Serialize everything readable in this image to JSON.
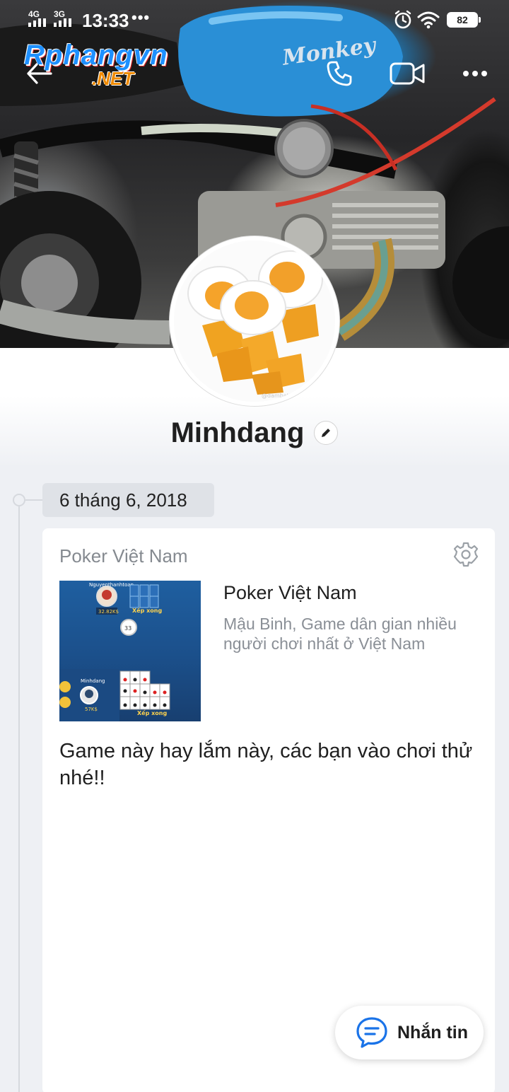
{
  "status_bar": {
    "network_1": "4G",
    "network_2": "3G",
    "time": "13:33",
    "dots": "•••",
    "battery": "82",
    "icons": [
      "alarm-icon",
      "wifi-icon",
      "battery-icon"
    ]
  },
  "cover": {
    "watermark_main": "Rphangvn",
    "watermark_sub": ".NET",
    "tank_text": "Monkey",
    "image_text": "@dambatthydaly"
  },
  "top_actions": {
    "icons": [
      "back-arrow-icon",
      "phone-icon",
      "video-call-icon",
      "more-icon"
    ]
  },
  "profile": {
    "name": "Minhdang",
    "edit_icon": "pencil-icon"
  },
  "timeline": {
    "date": "6 tháng 6, 2018"
  },
  "post": {
    "source": "Poker Việt Nam",
    "settings_icon": "gear-icon",
    "app_title": "Poker Việt Nam",
    "app_description": "Mậu Binh, Game dân gian nhiều người chơi nhất ở Việt Nam",
    "text": "Game này hay lắm này, các bạn vào chơi thử nhé!!",
    "thumbnail": {
      "player_top": "Nguyenthanhtoan",
      "player_top_coins": "32.82K$",
      "status_top": "Xếp xong",
      "timer": "33",
      "player_bottom": "Minhdang",
      "player_bottom_coins": "57K$",
      "status_bottom": "Xếp xong"
    }
  },
  "fab": {
    "label": "Nhắn tin",
    "icon": "chat-bubble-icon"
  },
  "colors": {
    "accent": "#1a73e8",
    "card_bg": "#ffffff",
    "page_bg": "#eef0f4",
    "date_chip_bg": "#dfe2e7"
  }
}
